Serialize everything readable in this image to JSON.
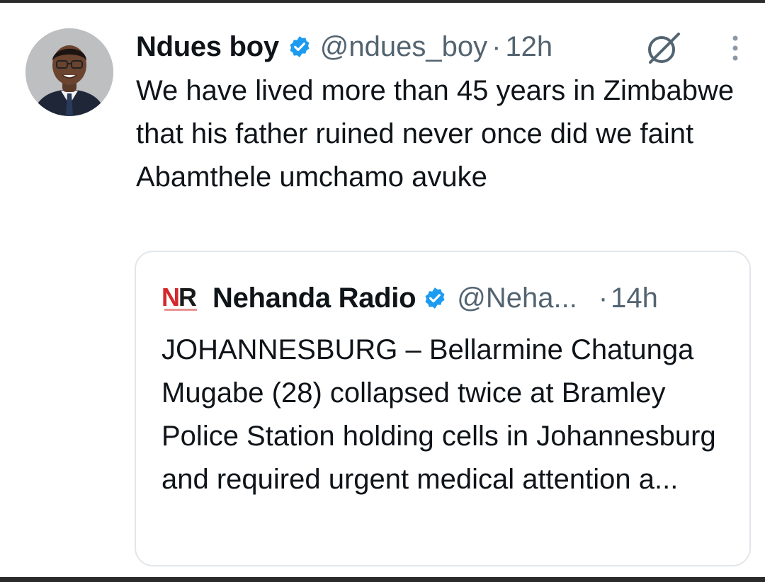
{
  "tweet": {
    "author": {
      "display_name": "Ndues boy",
      "handle": "@ndues_boy",
      "avatar_icon": "profile-photo"
    },
    "separator": "·",
    "time": "12h",
    "text": "We have lived more than 45 years in Zimbabwe that his father ruined never once did we faint Abamthele umchamo avuke",
    "icons": [
      "verified-badge-icon",
      "grok-icon",
      "more-options-icon"
    ]
  },
  "quoted_tweet": {
    "author": {
      "display_name": "Nehanda Radio",
      "handle": "@Neha...",
      "logo_text": "NR"
    },
    "separator": "·",
    "time": "14h",
    "text": "JOHANNESBURG – Bellarmine Chatunga Mugabe (28) collapsed twice at Bramley Police Station holding cells in Johannesburg and required urgent medical attention a..."
  },
  "colors": {
    "text_primary": "#0f1419",
    "text_secondary": "#536471",
    "verified_blue": "#1d9bf0",
    "border": "#e1e6ea",
    "logo_red": "#d4282a"
  }
}
